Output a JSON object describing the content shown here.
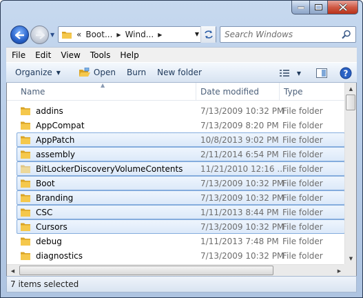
{
  "window": {
    "caption": {
      "min": "minimize",
      "max": "maximize",
      "close": "close"
    }
  },
  "nav": {
    "breadcrumb_prefix": "«",
    "crumbs": [
      "Boot...",
      "Wind..."
    ],
    "search_placeholder": "Search Windows"
  },
  "menu": [
    "File",
    "Edit",
    "View",
    "Tools",
    "Help"
  ],
  "commands": {
    "organize": "Organize",
    "open": "Open",
    "burn": "Burn",
    "new_folder": "New folder"
  },
  "columns": {
    "name": "Name",
    "date": "Date modified",
    "type": "Type"
  },
  "rows": [
    {
      "name": "addins",
      "date": "7/13/2009 10:32 PM",
      "type": "File folder",
      "selected": false,
      "hidden": false
    },
    {
      "name": "AppCompat",
      "date": "7/13/2009 8:20 PM",
      "type": "File folder",
      "selected": false,
      "hidden": false
    },
    {
      "name": "AppPatch",
      "date": "10/8/2013 9:02 PM",
      "type": "File folder",
      "selected": true,
      "hidden": false
    },
    {
      "name": "assembly",
      "date": "2/11/2014 6:54 PM",
      "type": "File folder",
      "selected": true,
      "hidden": false
    },
    {
      "name": "BitLockerDiscoveryVolumeContents",
      "date": "11/21/2010 12:16 ...",
      "type": "File folder",
      "selected": true,
      "hidden": true
    },
    {
      "name": "Boot",
      "date": "7/13/2009 10:32 PM",
      "type": "File folder",
      "selected": true,
      "hidden": false
    },
    {
      "name": "Branding",
      "date": "7/13/2009 10:32 PM",
      "type": "File folder",
      "selected": true,
      "hidden": false
    },
    {
      "name": "CSC",
      "date": "1/11/2013 8:44 PM",
      "type": "File folder",
      "selected": true,
      "hidden": false
    },
    {
      "name": "Cursors",
      "date": "7/13/2009 10:32 PM",
      "type": "File folder",
      "selected": true,
      "hidden": false
    },
    {
      "name": "debug",
      "date": "1/11/2013 7:48 PM",
      "type": "File folder",
      "selected": false,
      "hidden": false
    },
    {
      "name": "diagnostics",
      "date": "7/13/2009 10:32 PM",
      "type": "File folder",
      "selected": false,
      "hidden": false
    }
  ],
  "status": {
    "text": "7 items selected"
  },
  "colors": {
    "folder_yellow": "#f5c84c",
    "folder_dark": "#d9a325",
    "selection_border": "#84acdd",
    "command_text": "#1e395b"
  }
}
